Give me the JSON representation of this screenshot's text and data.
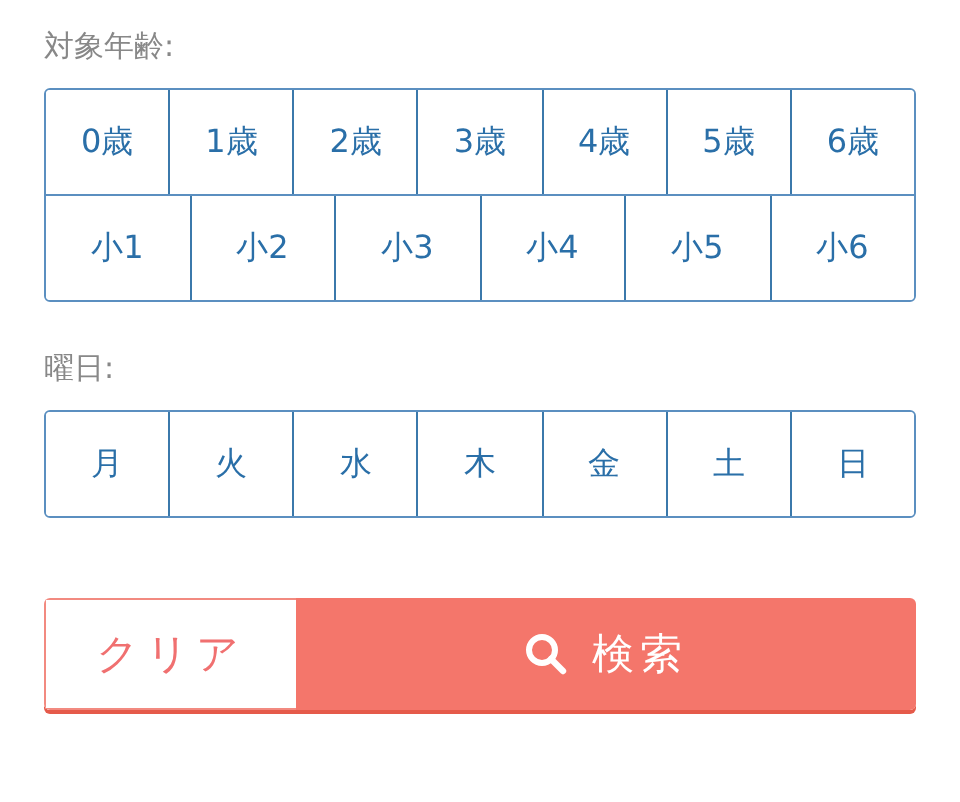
{
  "age_label": "対象年齢:",
  "age_rows": [
    [
      {
        "label": "0歳",
        "selected": false
      },
      {
        "label": "1歳",
        "selected": false
      },
      {
        "label": "2歳",
        "selected": false
      },
      {
        "label": "3歳",
        "selected": false
      },
      {
        "label": "4歳",
        "selected": false
      },
      {
        "label": "5歳",
        "selected": false
      },
      {
        "label": "6歳",
        "selected": false
      }
    ],
    [
      {
        "label": "小1",
        "selected": false
      },
      {
        "label": "小2",
        "selected": false
      },
      {
        "label": "小3",
        "selected": false
      },
      {
        "label": "小4",
        "selected": false
      },
      {
        "label": "小5",
        "selected": false
      },
      {
        "label": "小6",
        "selected": false
      }
    ]
  ],
  "day_label": "曜日:",
  "days": [
    {
      "label": "月",
      "selected": false
    },
    {
      "label": "火",
      "selected": false
    },
    {
      "label": "水",
      "selected": false
    },
    {
      "label": "木",
      "selected": false
    },
    {
      "label": "金",
      "selected": false
    },
    {
      "label": "土",
      "selected": false
    },
    {
      "label": "日",
      "selected": false
    }
  ],
  "clear_button": "クリア",
  "search_button": "検索"
}
